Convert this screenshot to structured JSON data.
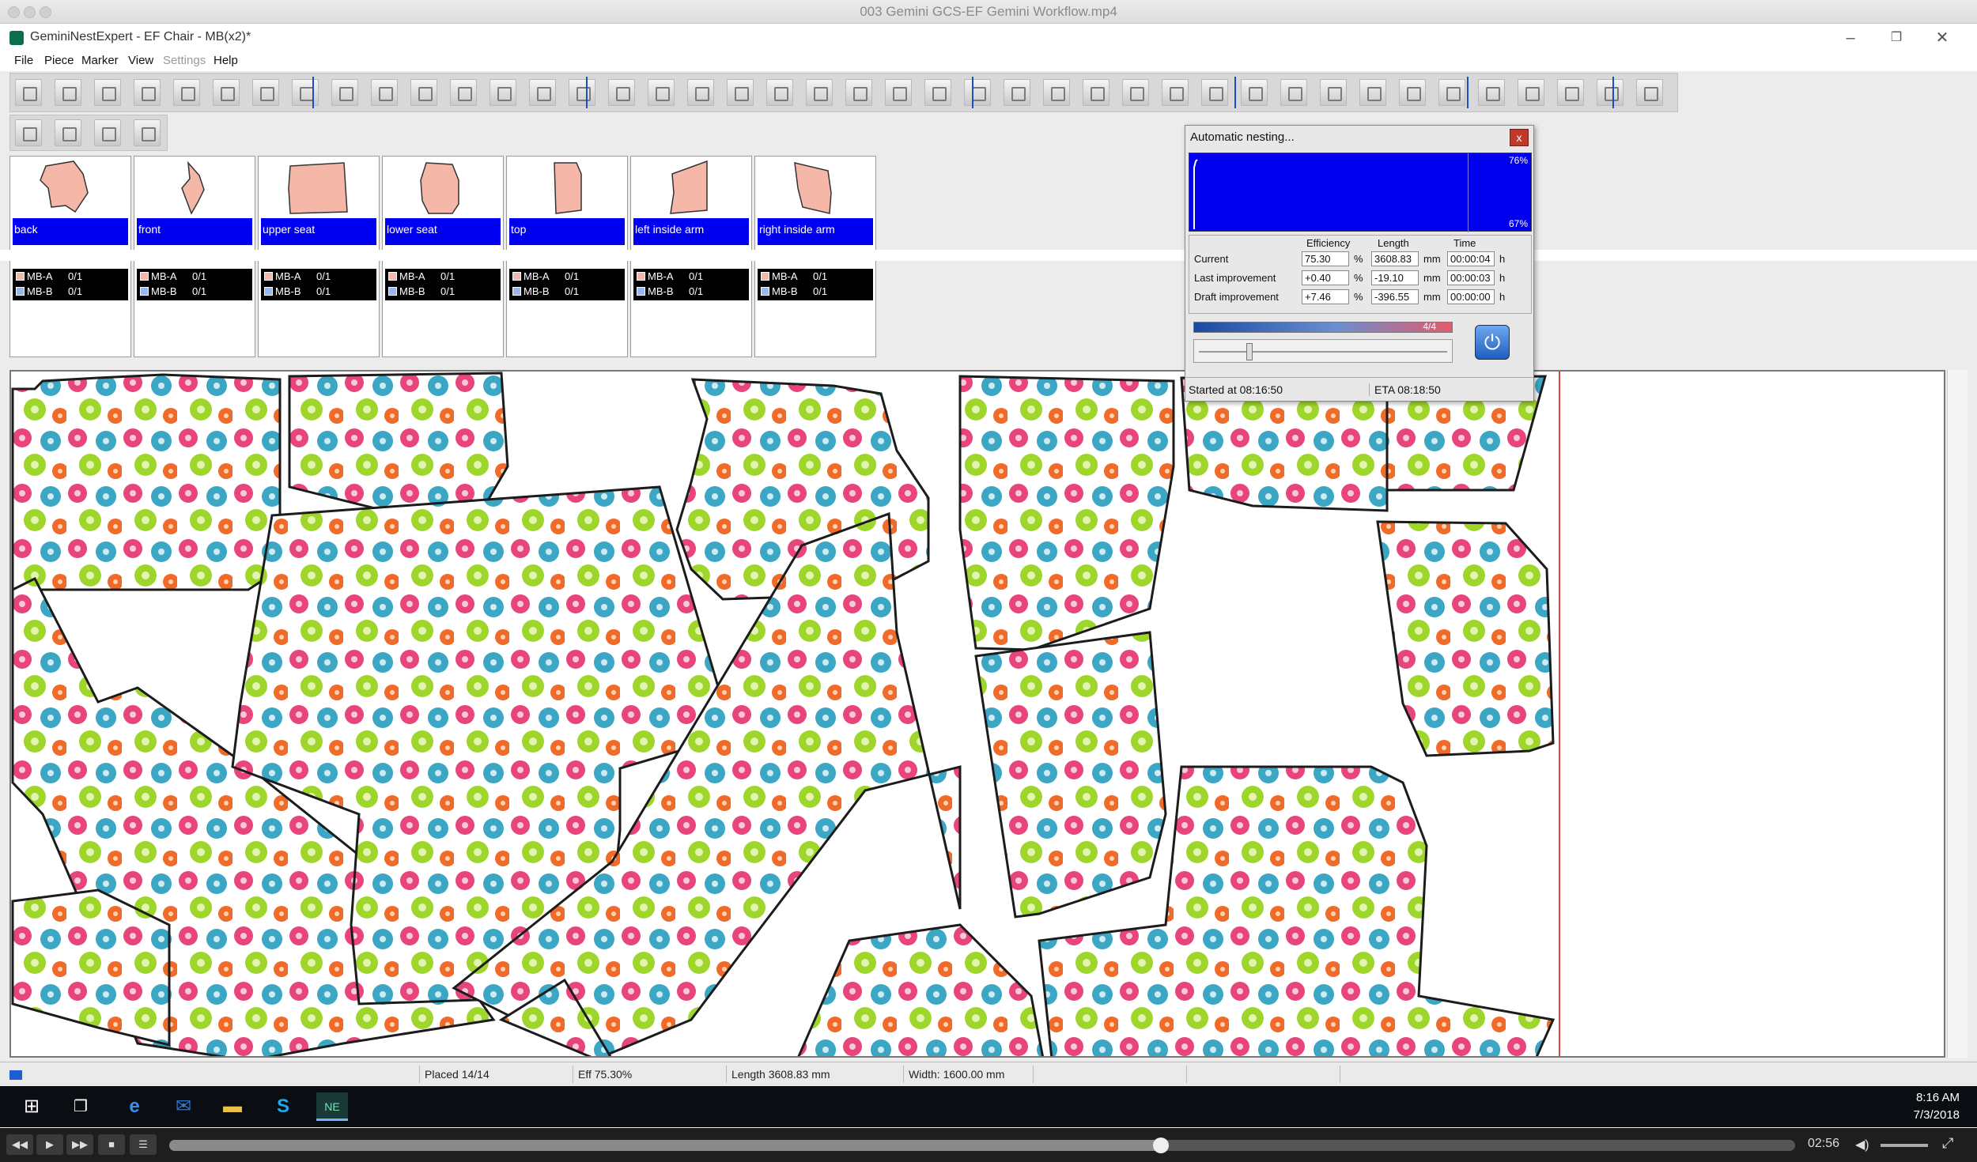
{
  "video_window": {
    "title": "003 Gemini GCS-EF Gemini Workflow.mp4"
  },
  "app": {
    "title": "GeminiNestExpert - EF Chair - MB(x2)*"
  },
  "menu": {
    "items": [
      "File",
      "Piece",
      "Marker",
      "View",
      "Settings",
      "Help"
    ]
  },
  "pieces": [
    {
      "label": "back",
      "color": "#f5b8a8",
      "models": [
        {
          "name": "MB-A",
          "qty": "0/1",
          "color": "#f5b8a8"
        },
        {
          "name": "MB-B",
          "qty": "0/1",
          "color": "#9ab8f0"
        }
      ]
    },
    {
      "label": "front",
      "color": "#f5b8a8",
      "models": [
        {
          "name": "MB-A",
          "qty": "0/1",
          "color": "#f5b8a8"
        },
        {
          "name": "MB-B",
          "qty": "0/1",
          "color": "#9ab8f0"
        }
      ]
    },
    {
      "label": "upper seat",
      "color": "#f5b8a8",
      "models": [
        {
          "name": "MB-A",
          "qty": "0/1",
          "color": "#f5b8a8"
        },
        {
          "name": "MB-B",
          "qty": "0/1",
          "color": "#9ab8f0"
        }
      ]
    },
    {
      "label": "lower seat",
      "color": "#f5b8a8",
      "models": [
        {
          "name": "MB-A",
          "qty": "0/1",
          "color": "#f5b8a8"
        },
        {
          "name": "MB-B",
          "qty": "0/1",
          "color": "#9ab8f0"
        }
      ]
    },
    {
      "label": "top",
      "color": "#f5b8a8",
      "models": [
        {
          "name": "MB-A",
          "qty": "0/1",
          "color": "#f5b8a8"
        },
        {
          "name": "MB-B",
          "qty": "0/1",
          "color": "#9ab8f0"
        }
      ]
    },
    {
      "label": "left inside arm",
      "color": "#f5b8a8",
      "models": [
        {
          "name": "MB-A",
          "qty": "0/1",
          "color": "#f5b8a8"
        },
        {
          "name": "MB-B",
          "qty": "0/1",
          "color": "#9ab8f0"
        }
      ]
    },
    {
      "label": "right inside arm",
      "color": "#f5b8a8",
      "models": [
        {
          "name": "MB-A",
          "qty": "0/1",
          "color": "#f5b8a8"
        },
        {
          "name": "MB-B",
          "qty": "0/1",
          "color": "#9ab8f0"
        }
      ]
    }
  ],
  "dialog": {
    "title": "Automatic nesting...",
    "close_label": "x",
    "graph_top_label": "76%",
    "graph_bottom_label": "67%",
    "headers": {
      "efficiency": "Efficiency",
      "length": "Length",
      "time": "Time"
    },
    "rows": [
      {
        "label": "Current",
        "efficiency": "75.30",
        "length": "3608.83",
        "time": "00:00:04"
      },
      {
        "label": "Last improvement",
        "efficiency": "+0.40",
        "length": "-19.10",
        "time": "00:00:03"
      },
      {
        "label": "Draft improvement",
        "efficiency": "+7.46",
        "length": "-396.55",
        "time": "00:00:00"
      }
    ],
    "units": {
      "percent": "%",
      "mm": "mm",
      "hours": "h"
    },
    "progress_label": "4/4",
    "progress_fraction": 1.0,
    "slider_fraction": 0.2,
    "started": "Started at 08:16:50",
    "eta": "ETA 08:18:50"
  },
  "status": {
    "placed": "Placed 14/14",
    "efficiency": "Eff 75.30%",
    "length": "Length 3608.83 mm",
    "width": "Width: 1600.00 mm"
  },
  "taskbar": {
    "time": "8:16 AM",
    "date": "7/3/2018"
  },
  "video": {
    "time": "02:56",
    "progress_fraction": 0.61
  },
  "colors": {
    "label_blue": "#0000f0",
    "dialog_graph": "#0000ee",
    "piece_fill": "#f5b8a8"
  }
}
